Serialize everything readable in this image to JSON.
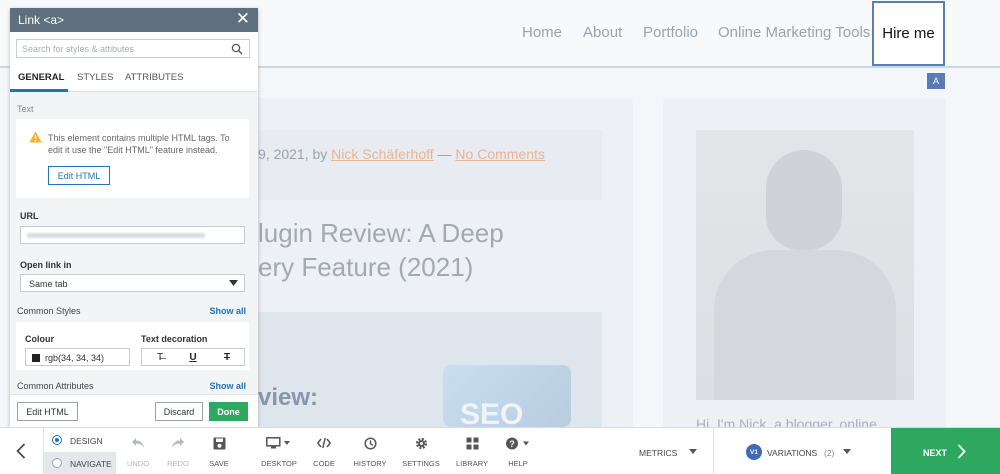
{
  "site": {
    "nav": [
      "Home",
      "About",
      "Portfolio",
      "Online Marketing Tools"
    ],
    "nav_active": "Hire me",
    "selected_badge": "A",
    "meta_date": "9, 2021, by ",
    "meta_author": "Nick Schäferhoff",
    "meta_sep": " — ",
    "meta_comments": "No Comments",
    "title_line1": "lugin Review: A Deep",
    "title_line2": "ery Feature (2021)",
    "hero_text": "view:",
    "hero_logo": "SEO",
    "bio": "Hi, I'm Nick, a blogger, online"
  },
  "panel": {
    "title": "Link  <a>",
    "close": "✕",
    "search_placeholder": "Search for styles & attibutes",
    "tabs": [
      "GENERAL",
      "STYLES",
      "ATTRIBUTES"
    ],
    "active_tab": "GENERAL",
    "section_text": "Text",
    "notice": "This element contains multiple HTML tags. To edit it use the \"Edit HTML\" feature instead.",
    "edit_html_inline": "Edit HTML",
    "url_label": "URL",
    "openin_label": "Open link in",
    "openin_value": "Same tab",
    "common_styles": "Common Styles",
    "show_all": "Show all",
    "colour_label": "Colour",
    "colour_value": "rgb(34, 34, 34)",
    "colour_swatch": "#222222",
    "textdec_label": "Text decoration",
    "dec_none": "T̶",
    "dec_underline": "U",
    "dec_strike": "T",
    "common_attributes": "Common Attributes",
    "footer": {
      "edit_html": "Edit HTML",
      "discard": "Discard",
      "done": "Done"
    }
  },
  "toolbar": {
    "modes": [
      "DESIGN",
      "NAVIGATE"
    ],
    "active_mode": "DESIGN",
    "tools": [
      {
        "label": "UNDO",
        "icon": "undo-icon",
        "enabled": false
      },
      {
        "label": "REDO",
        "icon": "redo-icon",
        "enabled": false
      },
      {
        "label": "SAVE",
        "icon": "save-icon",
        "enabled": true
      },
      {
        "label": "DESKTOP",
        "icon": "desktop-icon",
        "enabled": true
      },
      {
        "label": "CODE",
        "icon": "code-icon",
        "enabled": true
      },
      {
        "label": "HISTORY",
        "icon": "history-icon",
        "enabled": true
      },
      {
        "label": "SETTINGS",
        "icon": "gear-icon",
        "enabled": true
      },
      {
        "label": "LIBRARY",
        "icon": "library-icon",
        "enabled": true
      },
      {
        "label": "HELP",
        "icon": "help-icon",
        "enabled": true
      }
    ],
    "metrics": "METRICS",
    "variations_badge": "V1",
    "variations_label": "VARIATIONS",
    "variations_count": "(2)",
    "next": "NEXT"
  },
  "colors": {
    "accent": "#1f72c4",
    "success": "#2ea760",
    "panel_header": "#5f6f7d"
  }
}
